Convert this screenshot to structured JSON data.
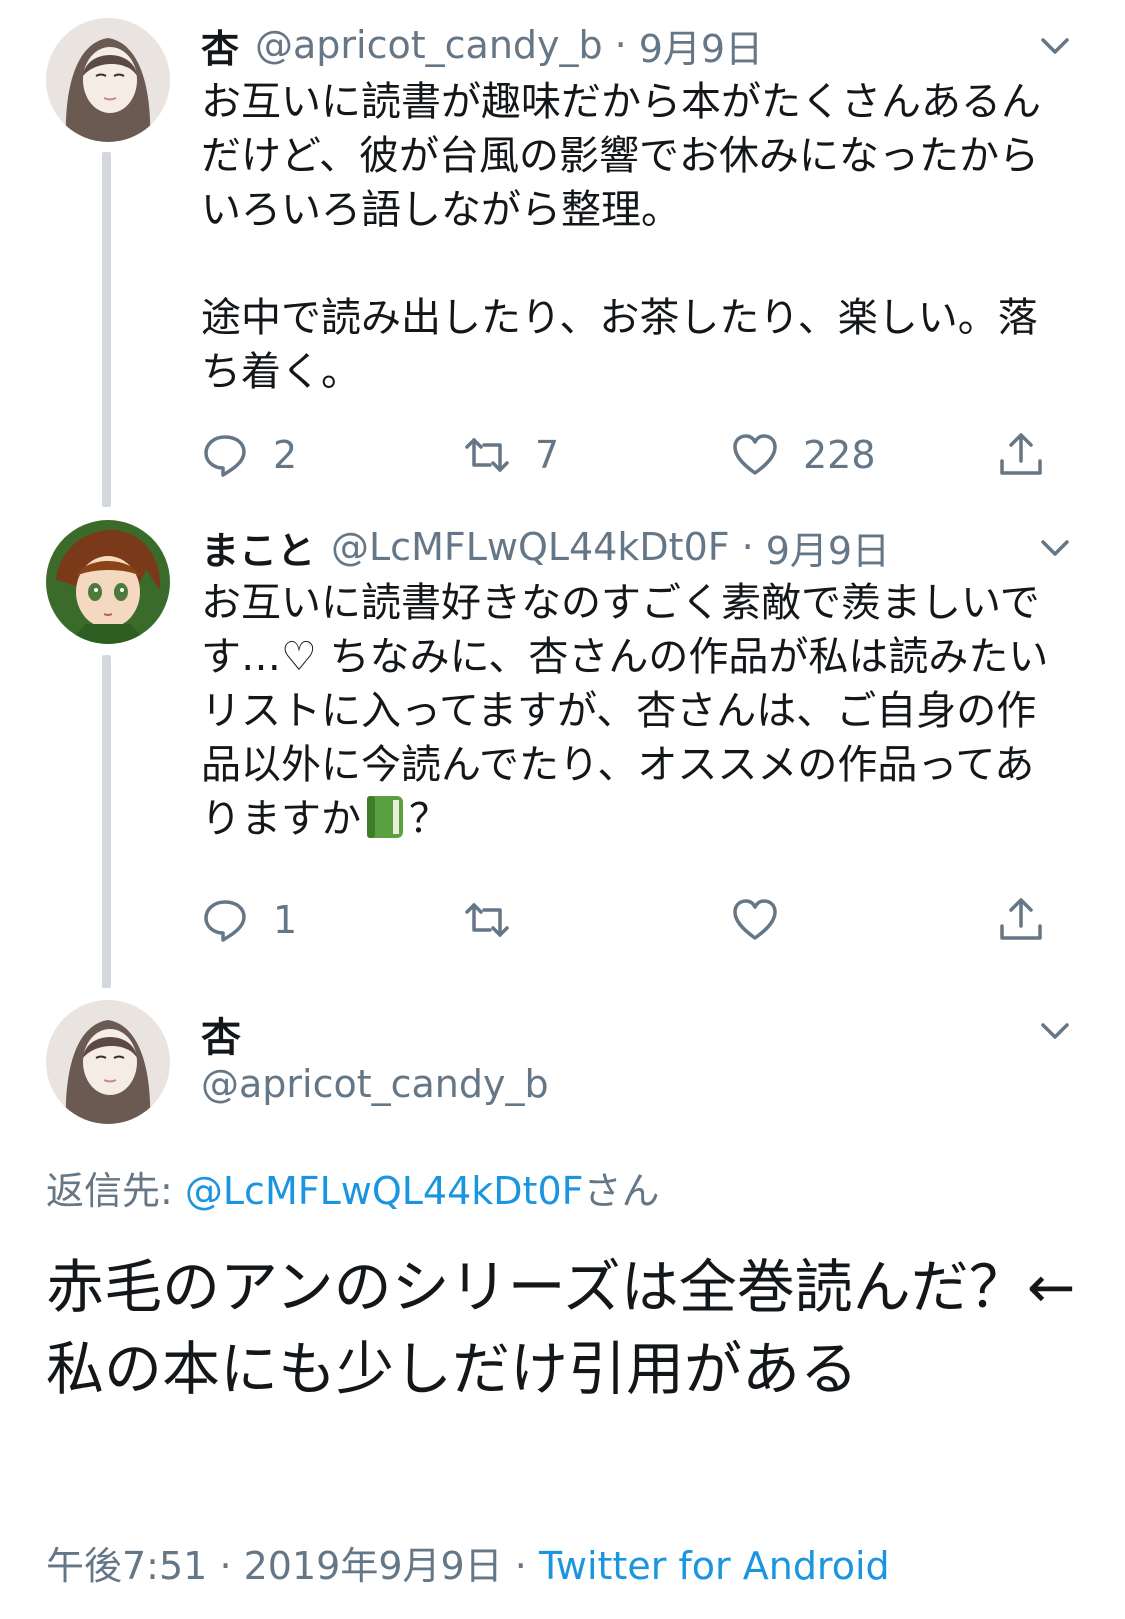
{
  "tweets": [
    {
      "name": "杏",
      "handle": "@apricot_candy_b",
      "date": "9月9日",
      "text": "お互いに読書が趣味だから本がたくさんあるんだけど、彼が台風の影響でお休みになったからいろいろ語しながら整理。\n\n途中で読み出したり、お茶したり、楽しい。落ち着く。",
      "replies": "2",
      "retweets": "7",
      "likes": "228"
    },
    {
      "name": "まこと",
      "handle": "@LcMFLwQL44kDt0F",
      "date": "9月9日",
      "text_before_emoji": "お互いに読書好きなのすごく素敵で羨ましいです…♡ ちなみに、杏さんの作品が私は読みたいリストに入ってますが、杏さんは、ご自身の作品以外に今読んでたり、オススメの作品ってありますか",
      "text_after_emoji": "？",
      "replies": "1",
      "retweets": "",
      "likes": ""
    }
  ],
  "main_tweet": {
    "name": "杏",
    "handle": "@apricot_candy_b",
    "reply_to_prefix": "返信先: ",
    "reply_to_handle": "@LcMFLwQL44kDt0F",
    "reply_to_suffix": "さん",
    "text": "赤毛のアンのシリーズは全巻読んだ？←私の本にも少しだけ引用がある",
    "time": "午後7:51",
    "date": "2019年9月9日",
    "source": "Twitter for Android",
    "separator": "·"
  },
  "icons": {
    "reply": "reply-icon",
    "retweet": "retweet-icon",
    "like": "heart-icon",
    "share": "share-icon",
    "menu": "chevron-down-icon",
    "emoji": "green-book-emoji"
  },
  "colors": {
    "text": "#14171a",
    "secondary": "#657786",
    "link": "#1b95e0",
    "thread_line": "#d3d8de"
  }
}
